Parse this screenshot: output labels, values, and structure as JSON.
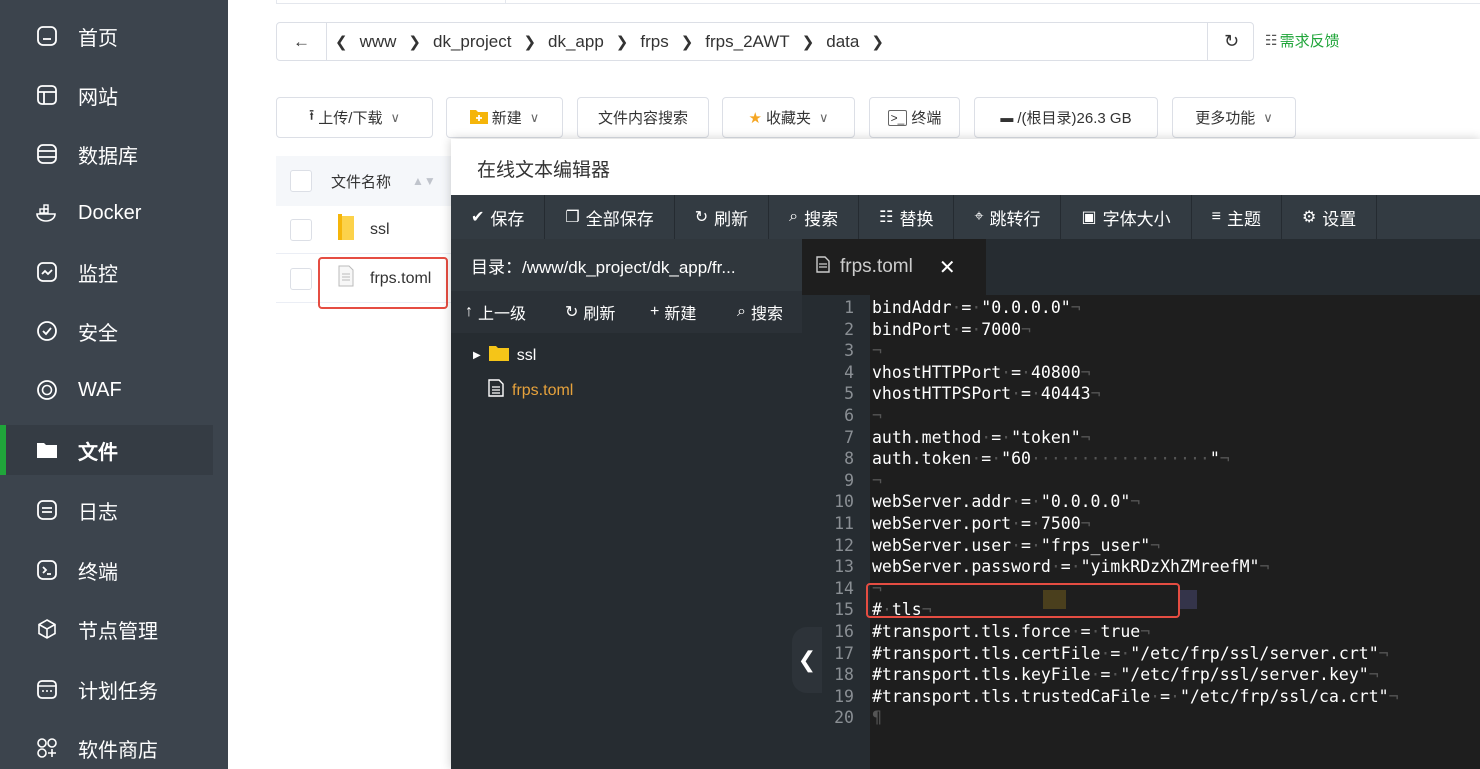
{
  "sidebar": {
    "items": [
      {
        "label": "首页",
        "icon": "home-icon"
      },
      {
        "label": "网站",
        "icon": "website-icon"
      },
      {
        "label": "数据库",
        "icon": "database-icon"
      },
      {
        "label": "Docker",
        "icon": "docker-icon"
      },
      {
        "label": "监控",
        "icon": "monitor-icon"
      },
      {
        "label": "安全",
        "icon": "shield-icon"
      },
      {
        "label": "WAF",
        "icon": "waf-icon"
      },
      {
        "label": "文件",
        "icon": "folder-icon"
      },
      {
        "label": "日志",
        "icon": "log-icon"
      },
      {
        "label": "终端",
        "icon": "terminal-icon"
      },
      {
        "label": "节点管理",
        "icon": "node-icon"
      },
      {
        "label": "计划任务",
        "icon": "calendar-icon"
      },
      {
        "label": "软件商店",
        "icon": "store-icon"
      }
    ],
    "active_index": 7,
    "accent_color": "#20a53a"
  },
  "path": {
    "crumbs": [
      "www",
      "dk_project",
      "dk_app",
      "frps",
      "frps_2AWT",
      "data"
    ],
    "feedback_label": "需求反馈"
  },
  "toolbar": {
    "upload_label": "上传/下载",
    "new_label": "新建",
    "search_label": "文件内容搜索",
    "favorites_label": "收藏夹",
    "terminal_label": "终端",
    "disk_label": "/(根目录)26.3 GB",
    "more_label": "更多功能"
  },
  "filelist": {
    "header": "文件名称",
    "rows": [
      "ssl",
      "frps.toml"
    ]
  },
  "editor": {
    "title": "在线文本编辑器",
    "toolbar": {
      "save": "保存",
      "save_all": "全部保存",
      "refresh": "刷新",
      "search": "搜索",
      "replace": "替换",
      "goto": "跳转行",
      "font_size": "字体大小",
      "theme": "主题",
      "settings": "设置"
    },
    "dir_title": "目录：/www/dk_project/dk_app/fr...",
    "dir_bar": {
      "up": "上一级",
      "refresh": "刷新",
      "new": "新建",
      "search": "搜索"
    },
    "tree": [
      "ssl",
      "frps.toml"
    ],
    "tab_label": "frps.toml",
    "lines": [
      "bindAddr = \"0.0.0.0\"",
      "bindPort = 7000",
      "",
      "vhostHTTPPort = 40800",
      "vhostHTTPSPort = 40443",
      "",
      "auth.method = \"token\"",
      "auth.token = \"60                  \"",
      "",
      "webServer.addr = \"0.0.0.0\"",
      "webServer.port = 7500",
      "webServer.user = \"frps_user\"",
      "webServer.password = \"yimkRDzXhZMreefM\"",
      "",
      "# tls",
      "#transport.tls.force = true",
      "#transport.tls.certFile = \"/etc/frp/ssl/server.crt\"",
      "#transport.tls.keyFile = \"/etc/frp/ssl/server.key\"",
      "#transport.tls.trustedCaFile = \"/etc/frp/ssl/ca.crt\"",
      ""
    ]
  }
}
